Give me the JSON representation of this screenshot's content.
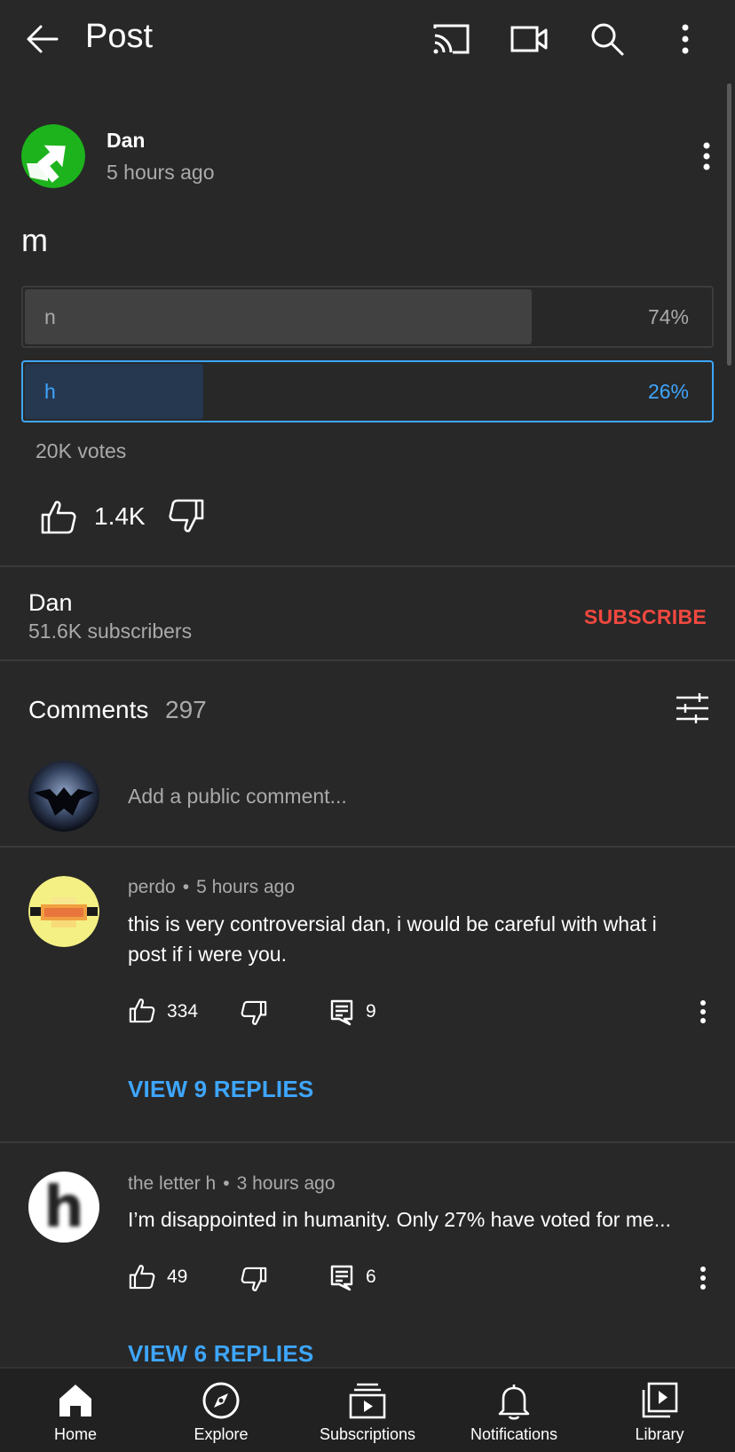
{
  "topbar": {
    "title": "Post"
  },
  "post": {
    "author": "Dan",
    "time": "5 hours ago",
    "text": "m",
    "poll": [
      {
        "label": "n",
        "percent": "74%",
        "fraction": 0.74,
        "selected": false
      },
      {
        "label": "h",
        "percent": "26%",
        "fraction": 0.26,
        "selected": true
      }
    ],
    "votes": "20K votes",
    "likes": "1.4K"
  },
  "channel": {
    "name": "Dan",
    "subscribers": "51.6K subscribers",
    "subscribe_label": "SUBSCRIBE"
  },
  "comments": {
    "title": "Comments",
    "count": "297",
    "add_placeholder": "Add a public comment...",
    "items": [
      {
        "author": "perdo",
        "dot": "•",
        "time": "5 hours ago",
        "text": "this is very controversial dan, i would be careful with what i post if i were you.",
        "likes": "334",
        "replies": "9",
        "view_replies": "VIEW 9 REPLIES"
      },
      {
        "author": "the letter h",
        "dot": "•",
        "time": "3 hours ago",
        "text": "I’m disappointed in humanity. Only 27% have voted for me...",
        "likes": "49",
        "replies": "6",
        "view_replies": "VIEW 6 REPLIES",
        "avatar_letter": "h"
      }
    ]
  },
  "nav": {
    "items": [
      {
        "label": "Home",
        "icon": "home-icon"
      },
      {
        "label": "Explore",
        "icon": "compass-icon"
      },
      {
        "label": "Subscriptions",
        "icon": "subscriptions-icon"
      },
      {
        "label": "Notifications",
        "icon": "bell-icon"
      },
      {
        "label": "Library",
        "icon": "library-icon"
      }
    ]
  },
  "colors": {
    "background": "#282828",
    "accent_blue": "#3ea6ff",
    "subscribe_red": "#f1483f",
    "secondary_text": "#aaaaaa"
  }
}
